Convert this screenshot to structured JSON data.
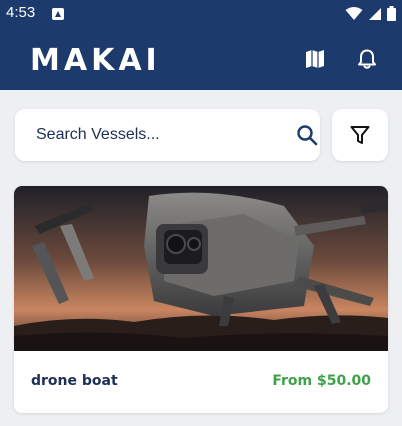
{
  "status_bar": {
    "time": "4:53",
    "icons": [
      "app-notification-icon",
      "wifi-icon",
      "signal-icon",
      "battery-icon"
    ]
  },
  "header": {
    "logo_text": "MAKAI",
    "actions": [
      "map-icon",
      "bell-icon"
    ]
  },
  "search": {
    "placeholder": "Search Vessels...",
    "value": "",
    "search_icon": "search-icon",
    "filter_icon": "filter-icon"
  },
  "listings": [
    {
      "name": "drone boat",
      "price": "From $50.00",
      "image": "drone-photo"
    }
  ],
  "colors": {
    "header_bg": "#1c3a6b",
    "page_bg": "#eeeff2",
    "card_bg": "#ffffff",
    "text_primary": "#1c2f55",
    "price_green": "#3ea14a"
  }
}
